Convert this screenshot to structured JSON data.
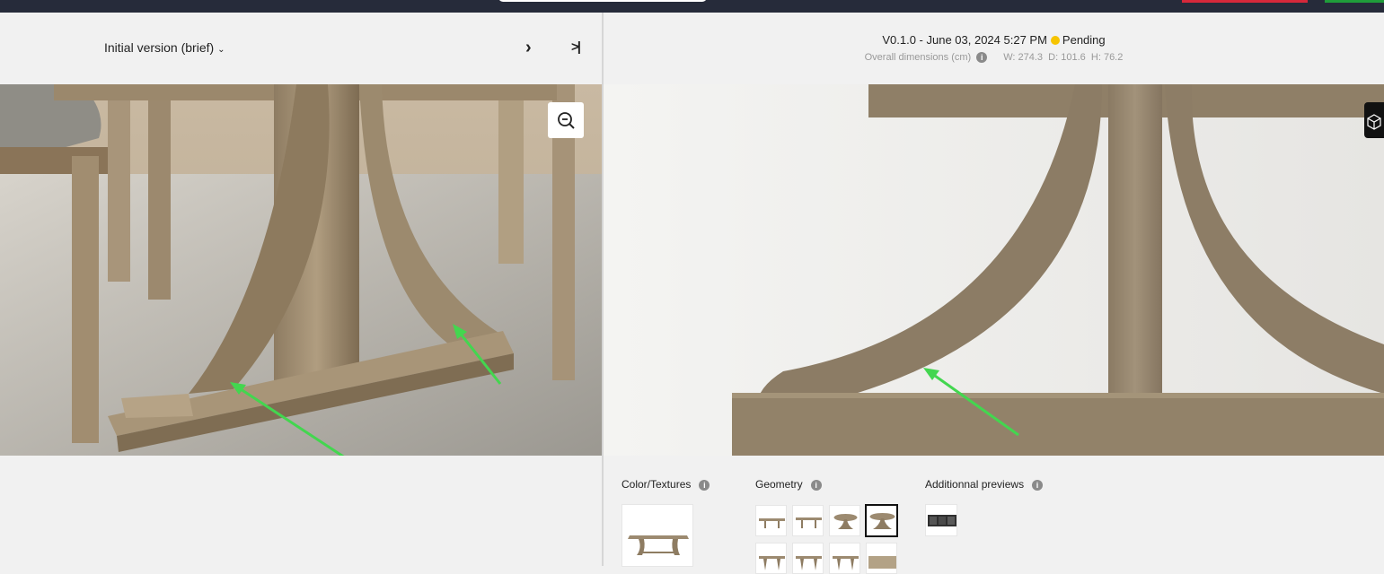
{
  "left_panel": {
    "version_select": {
      "label": "Initial version (brief)"
    }
  },
  "right_panel": {
    "version": "V0.1.0 - June 03, 2024 5:27 PM",
    "status": "Pending",
    "dimensions": {
      "label": "Overall dimensions (cm)",
      "width": "W: 274.3",
      "depth": "D: 101.6",
      "height": "H: 76.2"
    },
    "sections": {
      "color_textures": "Color/Textures",
      "geometry": "Geometry",
      "additional_previews": "Additionnal previews"
    }
  },
  "icons": {
    "next": "chevron-right-icon",
    "last": "skip-to-last-icon",
    "zoom_out": "zoom-out-icon",
    "info": "info-icon",
    "cube": "cube-3d-icon"
  },
  "colors": {
    "status_pending": "#f6c400",
    "annotation_arrow": "#43d64f",
    "topbar": "#262b3a"
  }
}
